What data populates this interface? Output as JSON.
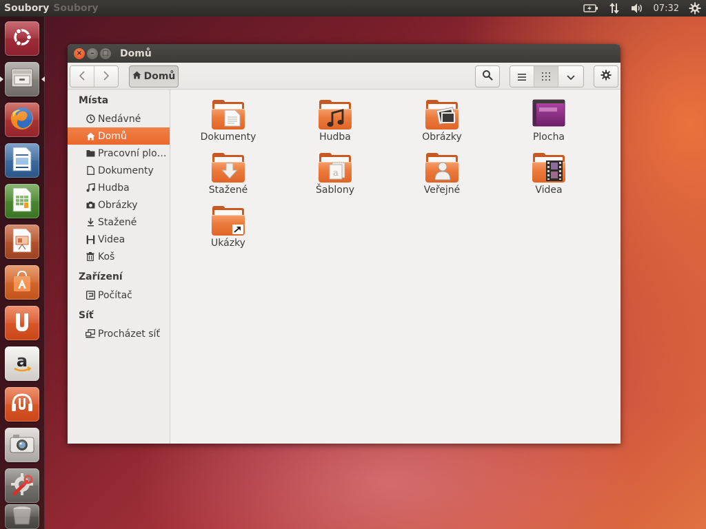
{
  "top_panel": {
    "app_name": "Soubory",
    "app_name_ghost": "Soubory",
    "clock": "07:32",
    "indicators": [
      "battery-icon",
      "network-transfer-icon",
      "volume-icon",
      "clock",
      "system-gear-icon"
    ]
  },
  "launcher": {
    "items": [
      {
        "name": "dash-home",
        "icon": "ubuntu-logo-icon"
      },
      {
        "name": "files",
        "icon": "file-cabinet-icon",
        "active": true
      },
      {
        "name": "firefox",
        "icon": "firefox-icon"
      },
      {
        "name": "libreoffice-writer",
        "icon": "writer-document-icon"
      },
      {
        "name": "libreoffice-calc",
        "icon": "calc-spreadsheet-icon"
      },
      {
        "name": "libreoffice-impress",
        "icon": "impress-presentation-icon"
      },
      {
        "name": "software-center",
        "icon": "software-center-bag-icon"
      },
      {
        "name": "ubuntu-one",
        "icon": "ubuntu-one-icon"
      },
      {
        "name": "amazon",
        "icon": "amazon-icon"
      },
      {
        "name": "ubuntu-one-music",
        "icon": "ubuntu-one-music-icon"
      },
      {
        "name": "shotwell",
        "icon": "camera-icon"
      },
      {
        "name": "system-settings",
        "icon": "settings-wrench-icon"
      },
      {
        "name": "trash",
        "icon": "trash-icon"
      }
    ]
  },
  "window": {
    "title": "Domů",
    "buttons": {
      "close": "×",
      "minimize": "–",
      "maximize": "□"
    },
    "toolbar": {
      "back": "‹",
      "forward": "›",
      "location_label": "Domů",
      "search_icon": "search-icon",
      "view_list_icon": "list-view-icon",
      "view_grid_icon": "grid-view-icon",
      "view_menu_icon": "chevron-down-icon",
      "settings_icon": "gear-icon"
    },
    "sidebar": {
      "places_heading": "Místa",
      "places": [
        {
          "label": "Nedávné",
          "icon": "clock-icon"
        },
        {
          "label": "Domů",
          "icon": "home-icon",
          "selected": true
        },
        {
          "label": "Pracovní plo…",
          "icon": "desktop-folder-icon"
        },
        {
          "label": "Dokumenty",
          "icon": "document-icon"
        },
        {
          "label": "Hudba",
          "icon": "music-note-icon"
        },
        {
          "label": "Obrázky",
          "icon": "camera-icon"
        },
        {
          "label": "Stažené",
          "icon": "download-arrow-icon"
        },
        {
          "label": "Videa",
          "icon": "film-icon"
        },
        {
          "label": "Koš",
          "icon": "trash-icon"
        }
      ],
      "devices_heading": "Zařízení",
      "devices": [
        {
          "label": "Počítač",
          "icon": "computer-icon"
        }
      ],
      "network_heading": "Síť",
      "network": [
        {
          "label": "Procházet síť",
          "icon": "network-icon"
        }
      ]
    },
    "files": [
      {
        "name": "Dokumenty",
        "emblem": "document-emblem-icon"
      },
      {
        "name": "Hudba",
        "emblem": "music-emblem-icon"
      },
      {
        "name": "Obrázky",
        "emblem": "picture-emblem-icon"
      },
      {
        "name": "Plocha",
        "emblem": "desktop-emblem-icon"
      },
      {
        "name": "Stažené",
        "emblem": "download-emblem-icon"
      },
      {
        "name": "Šablony",
        "emblem": "template-emblem-icon"
      },
      {
        "name": "Veřejné",
        "emblem": "person-emblem-icon"
      },
      {
        "name": "Videa",
        "emblem": "film-emblem-icon"
      },
      {
        "name": "Ukázky",
        "emblem": "link-arrow-emblem-icon"
      }
    ]
  },
  "colors": {
    "accent": "#e9682c",
    "panel": "#3c3b37",
    "window_bg": "#f2f1f0"
  }
}
